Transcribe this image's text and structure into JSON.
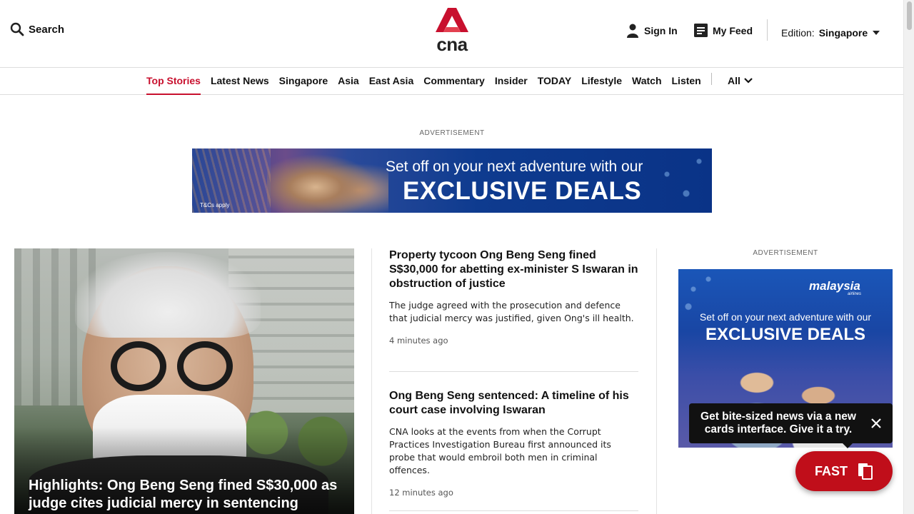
{
  "header": {
    "search_label": "Search",
    "logo_text": "cna",
    "signin_label": "Sign In",
    "myfeed_label": "My Feed",
    "edition_label": "Edition:",
    "edition_value": "Singapore",
    "brand_color": "#c8102e"
  },
  "nav": {
    "items": [
      {
        "label": "Top Stories",
        "active": true
      },
      {
        "label": "Latest News"
      },
      {
        "label": "Singapore"
      },
      {
        "label": "Asia"
      },
      {
        "label": "East Asia"
      },
      {
        "label": "Commentary"
      },
      {
        "label": "Insider"
      },
      {
        "label": "TODAY"
      },
      {
        "label": "Lifestyle"
      },
      {
        "label": "Watch"
      },
      {
        "label": "Listen"
      }
    ],
    "all_label": "All"
  },
  "ads": {
    "label": "ADVERTISEMENT",
    "banner": {
      "line1": "Set off on your next adventure with our",
      "line2": "EXCLUSIVE DEALS",
      "tcs": "T&Cs apply"
    },
    "side": {
      "brand": "malaysia",
      "brand_sub": "airlines",
      "line1": "Set off on your next adventure with our",
      "line2": "EXCLUSIVE DEALS"
    }
  },
  "hero": {
    "title": "Highlights: Ong Beng Seng fined S$30,000 as judge cites judicial mercy in sentencing"
  },
  "articles": [
    {
      "title": "Property tycoon Ong Beng Seng fined S$30,000 for abetting ex-minister S Iswaran in obstruction of justice",
      "summary": "The judge agreed with the prosecution and defence that judicial mercy was justified, given Ong's ill health.",
      "time": "4 minutes ago"
    },
    {
      "title": "Ong Beng Seng sentenced: A timeline of his court case involving Iswaran",
      "summary": "CNA looks at the events from when the Corrupt Practices Investigation Bureau first announced its probe that would embroil both men in criminal offences.",
      "time": "12 minutes ago"
    }
  ],
  "tooltip": {
    "text": "Get bite-sized news via a new cards interface. Give it a try."
  },
  "fast": {
    "label": "FAST"
  }
}
